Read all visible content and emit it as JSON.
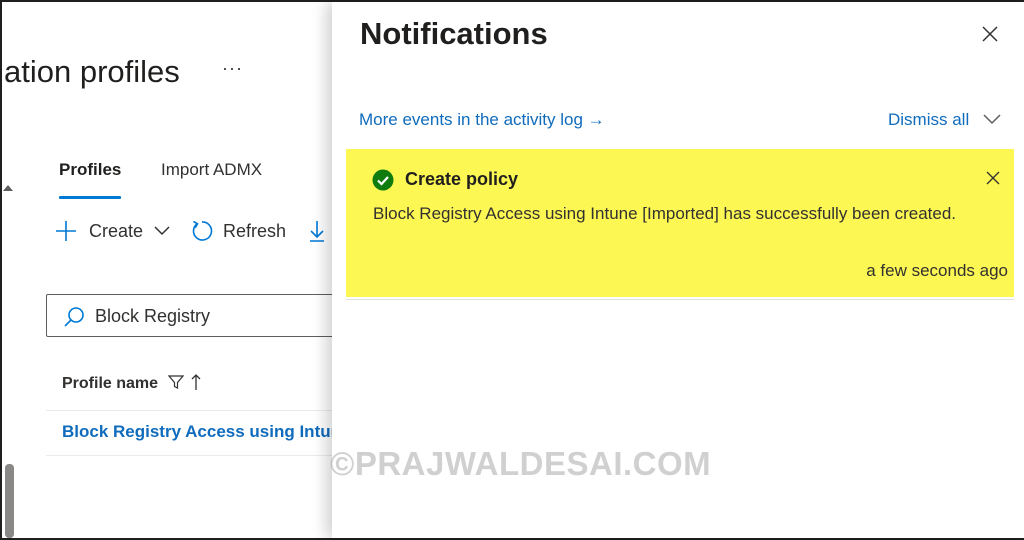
{
  "page": {
    "title": "ation profiles",
    "more_label": "···"
  },
  "tabs": [
    {
      "label": "Profiles",
      "active": true
    },
    {
      "label": "Import ADMX",
      "active": false
    }
  ],
  "toolbar": {
    "create_label": "Create",
    "refresh_label": "Refresh"
  },
  "search": {
    "value": "Block Registry"
  },
  "table": {
    "column_header": "Profile name",
    "rows": [
      "Block Registry Access using Intune"
    ]
  },
  "notifications": {
    "title": "Notifications",
    "activity_log_link": "More events in the activity log →",
    "dismiss_all_label": "Dismiss all",
    "items": [
      {
        "title": "Create policy",
        "message": "Block Registry Access using Intune [Imported] has successfully been created.",
        "time": "a few seconds ago",
        "status": "success-icon"
      }
    ]
  },
  "watermark": "©PRAJWALDESAI.COM",
  "colors": {
    "accent": "#0078d4",
    "link": "#0f6cbd",
    "success": "#107c10",
    "highlight": "#fcf752"
  }
}
